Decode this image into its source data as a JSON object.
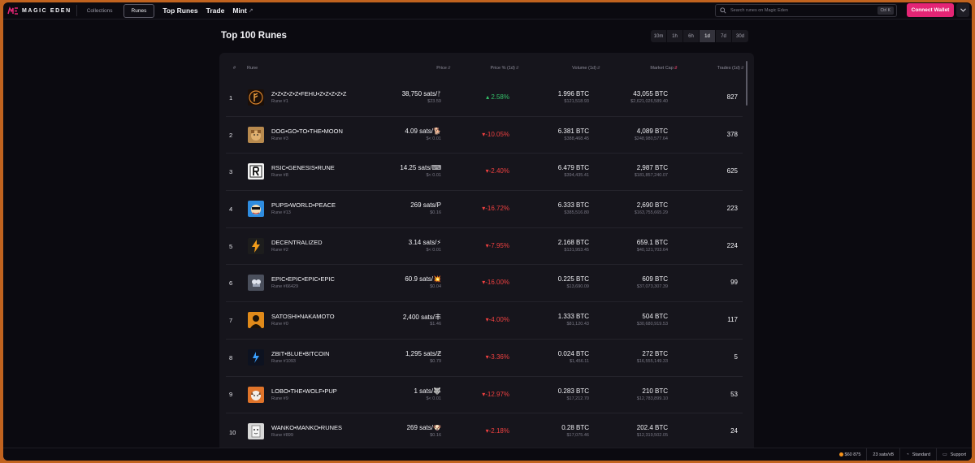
{
  "nav": {
    "logo_text": "MAGIC EDEN",
    "tabs": [
      {
        "label": "Collections",
        "active": false
      },
      {
        "label": "Runes",
        "active": true
      }
    ],
    "links": [
      "Top Runes",
      "Trade",
      "Mint"
    ],
    "search_placeholder": "Search runes on Magic Eden",
    "search_shortcut": "Ctrl K",
    "connect_label": "Connect Wallet"
  },
  "page": {
    "title": "Top 100 Runes",
    "periods": [
      {
        "label": "10m",
        "active": false
      },
      {
        "label": "1h",
        "active": false
      },
      {
        "label": "6h",
        "active": false
      },
      {
        "label": "1d",
        "active": true
      },
      {
        "label": "7d",
        "active": false
      },
      {
        "label": "30d",
        "active": false
      }
    ]
  },
  "table": {
    "headers": {
      "rank": "#",
      "rune": "Rune",
      "price": "Price",
      "price_pct": "Price % (1d)",
      "volume": "Volume (1d)",
      "market_cap": "Market Cap",
      "trades": "Trades (1d)"
    },
    "rows": [
      {
        "rank": "1",
        "name": "Z•Z•Z•Z•Z•FEHU•Z•Z•Z•Z•Z",
        "sub": "Rune #1",
        "price": "38,750 sats/ᚠ",
        "price_usd": "$23.59",
        "pct": "2.58%",
        "dir": "up",
        "volume": "1.996 BTC",
        "volume_usd": "$121,518.93",
        "mcap": "43,055 BTC",
        "mcap_usd": "$2,621,026,589.40",
        "trades": "827",
        "icon": "fehu-rune-icon",
        "color": "#1b0f08"
      },
      {
        "rank": "2",
        "name": "DOG•GO•TO•THE•MOON",
        "sub": "Rune #3",
        "price": "4.09 sats/🐕",
        "price_usd": "$< 0.01",
        "pct": "-10.05%",
        "dir": "down",
        "volume": "6.381 BTC",
        "volume_usd": "$388,468.45",
        "mcap": "4,089 BTC",
        "mcap_usd": "$248,980,577.64",
        "trades": "378",
        "icon": "dog-icon",
        "color": "#b88a4e"
      },
      {
        "rank": "3",
        "name": "RSIC•GENESIS•RUNE",
        "sub": "Rune #8",
        "price": "14.25 sats/⌨",
        "price_usd": "$< 0.01",
        "pct": "-2.40%",
        "dir": "down",
        "volume": "6.479 BTC",
        "volume_usd": "$394,435.41",
        "mcap": "2,987 BTC",
        "mcap_usd": "$181,857,240.07",
        "trades": "625",
        "icon": "rsic-icon",
        "color": "#f2f2f2"
      },
      {
        "rank": "4",
        "name": "PUPS•WORLD•PEACE",
        "sub": "Rune #13",
        "price": "269 sats/P",
        "price_usd": "$0.16",
        "pct": "-16.72%",
        "dir": "down",
        "volume": "6.333 BTC",
        "volume_usd": "$385,516.80",
        "mcap": "2,690 BTC",
        "mcap_usd": "$163,755,665.29",
        "trades": "223",
        "icon": "pups-icon",
        "color": "#2f8de0"
      },
      {
        "rank": "5",
        "name": "DECENTRALIZED",
        "sub": "Rune #2",
        "price": "3.14 sats/⚡",
        "price_usd": "$< 0.01",
        "pct": "-7.95%",
        "dir": "down",
        "volume": "2.168 BTC",
        "volume_usd": "$131,953.45",
        "mcap": "659.1 BTC",
        "mcap_usd": "$40,121,703.64",
        "trades": "224",
        "icon": "lightning-icon",
        "color": "#1d1d1d"
      },
      {
        "rank": "6",
        "name": "EPIC•EPIC•EPIC•EPIC",
        "sub": "Rune #66429",
        "price": "60.9 sats/💥",
        "price_usd": "$0.04",
        "pct": "-16.00%",
        "dir": "down",
        "volume": "0.225 BTC",
        "volume_usd": "$13,690.09",
        "mcap": "609 BTC",
        "mcap_usd": "$37,073,307.39",
        "trades": "99",
        "icon": "epic-icon",
        "color": "#4a4f5c"
      },
      {
        "rank": "7",
        "name": "SATOSHI•NAKAMOTO",
        "sub": "Rune #0",
        "price": "2,400 sats/丰",
        "price_usd": "$1.46",
        "pct": "-4.00%",
        "dir": "down",
        "volume": "1.333 BTC",
        "volume_usd": "$81,120.43",
        "mcap": "504 BTC",
        "mcap_usd": "$30,680,919.53",
        "trades": "117",
        "icon": "satoshi-icon",
        "color": "#e08a1a"
      },
      {
        "rank": "8",
        "name": "ZBIT•BLUE•BITCOIN",
        "sub": "Rune #1093",
        "price": "1,295 sats/Ƶ",
        "price_usd": "$0.79",
        "pct": "-3.36%",
        "dir": "down",
        "volume": "0.024 BTC",
        "volume_usd": "$1,456.11",
        "mcap": "272 BTC",
        "mcap_usd": "$16,555,149.33",
        "trades": "5",
        "icon": "zbit-icon",
        "color": "#0d1220"
      },
      {
        "rank": "9",
        "name": "LOBO•THE•WOLF•PUP",
        "sub": "Rune #9",
        "price": "1 sats/🐺",
        "price_usd": "$< 0.01",
        "pct": "-12.97%",
        "dir": "down",
        "volume": "0.283 BTC",
        "volume_usd": "$17,212.70",
        "mcap": "210 BTC",
        "mcap_usd": "$12,783,899.10",
        "trades": "53",
        "icon": "wolf-icon",
        "color": "#e0742a"
      },
      {
        "rank": "10",
        "name": "WANKO•MANKO•RUNES",
        "sub": "Rune #899",
        "price": "269 sats/🐶",
        "price_usd": "$0.16",
        "pct": "-2.18%",
        "dir": "down",
        "volume": "0.28 BTC",
        "volume_usd": "$17,075.46",
        "mcap": "202.4 BTC",
        "mcap_usd": "$12,319,502.05",
        "trades": "24",
        "icon": "wanko-icon",
        "color": "#d8d8d8"
      }
    ]
  },
  "status": {
    "btc_price": "$60 875",
    "fee": "23 sats/vB",
    "mode": "Standard",
    "support": "Support"
  },
  "colors": {
    "accent": "#e42575",
    "up": "#35c26a",
    "down": "#ef4040",
    "background": "#0b0a10",
    "panel": "#16151c"
  }
}
